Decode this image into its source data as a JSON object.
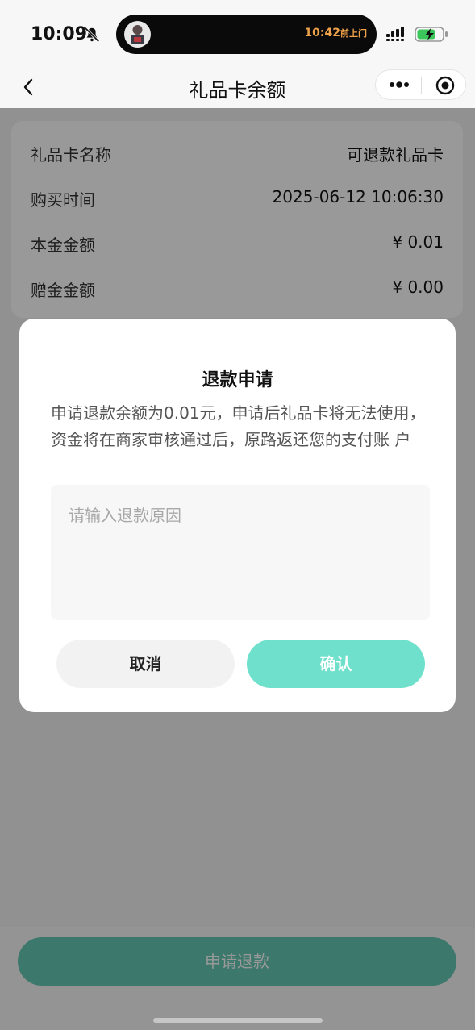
{
  "status_bar": {
    "time": "10:09",
    "island_time": "10:42",
    "island_text": "前上门",
    "icons": [
      "bell-off-icon",
      "signal-icon",
      "battery-charging-icon"
    ]
  },
  "nav": {
    "title": "礼品卡余额",
    "back_icon": "chevron-left-icon",
    "more_icon": "more-dots-icon",
    "close_icon": "target-circle-icon"
  },
  "card_info": {
    "rows": [
      {
        "label": "礼品卡名称",
        "value": "可退款礼品卡"
      },
      {
        "label": "购买时间",
        "value": "2025-06-12 10:06:30"
      },
      {
        "label": "本金金额",
        "value": "¥ 0.01"
      },
      {
        "label": "赠金金额",
        "value": "¥ 0.00"
      }
    ]
  },
  "bottom": {
    "refund_label": "申请退款"
  },
  "dialog": {
    "title": "退款申请",
    "message": "申请退款余额为0.01元，申请后礼品卡将无法使用，资金将在商家审核通过后，原路返还您的支付账 户",
    "reason_placeholder": "请输入退款原因",
    "reason_value": "",
    "cancel_label": "取消",
    "confirm_label": "确认"
  },
  "colors": {
    "accent": "#6ee0cc",
    "accent_dimmed": "#65c9b2",
    "mask": "rgba(0,0,0,0.40)"
  }
}
